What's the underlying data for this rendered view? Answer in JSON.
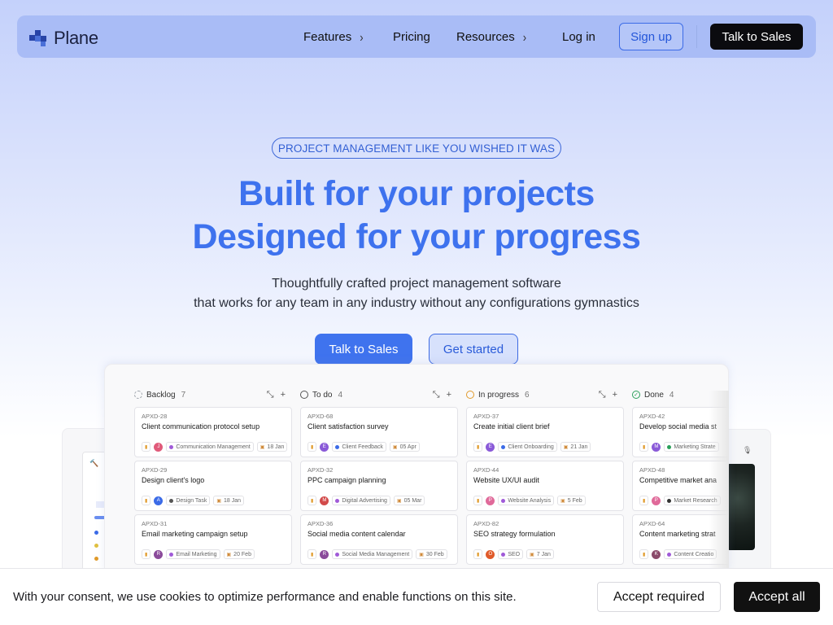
{
  "nav": {
    "logo_text": "Plane",
    "links": [
      {
        "label": "Features",
        "has_chevron": true
      },
      {
        "label": "Pricing",
        "has_chevron": false
      },
      {
        "label": "Resources",
        "has_chevron": true
      },
      {
        "label": "Log in",
        "has_chevron": false
      }
    ],
    "signup_label": "Sign up",
    "sales_label": "Talk to Sales"
  },
  "hero": {
    "badge": "PROJECT MANAGEMENT LIKE YOU WISHED IT WAS",
    "title_line1": "Built for your projects",
    "title_line2": "Designed for your progress",
    "sub_line1": "Thoughtfully crafted project management software",
    "sub_line2": "that works for any team in any industry without any configurations gymnastics",
    "cta_primary": "Talk to Sales",
    "cta_secondary": "Get started"
  },
  "board": {
    "columns": [
      {
        "name": "Backlog",
        "count": "7",
        "icon_color": "#9aa0a8",
        "icon_style": "dashed",
        "cards": [
          {
            "id": "APXD-28",
            "title": "Client communication protocol setup",
            "avatar": "J",
            "avatar_color": "#e05a7a",
            "label": "Communication Management",
            "label_color": "#a05ad8",
            "date": "18 Jan"
          },
          {
            "id": "APXD-29",
            "title": "Design client's logo",
            "avatar": "A",
            "avatar_color": "#3b6be7",
            "label": "Design Task",
            "label_color": "#555",
            "date": "18 Jan"
          },
          {
            "id": "APXD-31",
            "title": "Email marketing campaign setup",
            "avatar": "R",
            "avatar_color": "#8a4a9a",
            "label": "Email Marketing",
            "label_color": "#a05ad8",
            "date": "20 Feb"
          }
        ]
      },
      {
        "name": "To do",
        "count": "4",
        "icon_color": "#555",
        "icon_style": "solid",
        "cards": [
          {
            "id": "APXD-68",
            "title": "Client satisfaction survey",
            "avatar": "E",
            "avatar_color": "#8a5ad8",
            "label": "Client Feedback",
            "label_color": "#3b6be7",
            "date": "05 Apr"
          },
          {
            "id": "APXD-32",
            "title": "PPC campaign planning",
            "avatar": "M",
            "avatar_color": "#d24a4a",
            "label": "Digital Advertising",
            "label_color": "#a05ad8",
            "date": "05 Mar"
          },
          {
            "id": "APXD-36",
            "title": "Social media content calendar",
            "avatar": "R",
            "avatar_color": "#8a4a9a",
            "label": "Social Media Management",
            "label_color": "#a05ad8",
            "date": "30 Feb"
          }
        ]
      },
      {
        "name": "In progress",
        "count": "6",
        "icon_color": "#e09a2a",
        "icon_style": "solid",
        "cards": [
          {
            "id": "APXD-37",
            "title": "Create initial client brief",
            "avatar": "E",
            "avatar_color": "#8a5ad8",
            "label": "Client Onboarding",
            "label_color": "#3b6be7",
            "date": "21 Jan"
          },
          {
            "id": "APXD-44",
            "title": "Website UX/UI audit",
            "avatar": "P",
            "avatar_color": "#e06a9a",
            "label": "Website Analysis",
            "label_color": "#a05ad8",
            "date": "5 Feb"
          },
          {
            "id": "APXD-82",
            "title": "SEO strategy formulation",
            "avatar": "O",
            "avatar_color": "#e05a2a",
            "label": "SEO",
            "label_color": "#a05ad8",
            "date": "7 Jan"
          }
        ]
      },
      {
        "name": "Done",
        "count": "4",
        "icon_color": "#2aa05a",
        "icon_style": "check",
        "cards": [
          {
            "id": "APXD-42",
            "title": "Develop social media st",
            "avatar": "M",
            "avatar_color": "#8a5ad8",
            "label": "Marketing Strate",
            "label_color": "#2aa05a",
            "date": ""
          },
          {
            "id": "APXD-48",
            "title": "Competitive market ana",
            "avatar": "P",
            "avatar_color": "#e06a9a",
            "label": "Market Research",
            "label_color": "#333",
            "date": ""
          },
          {
            "id": "APXD-64",
            "title": "Content marketing strat",
            "avatar": "K",
            "avatar_color": "#8a4a6a",
            "label": "Content Creatio",
            "label_color": "#a05ad8",
            "date": ""
          }
        ]
      }
    ]
  },
  "cookie": {
    "text": "With your consent, we use cookies to optimize performance and enable functions on this site.",
    "accept_required": "Accept required",
    "accept_all": "Accept all"
  }
}
